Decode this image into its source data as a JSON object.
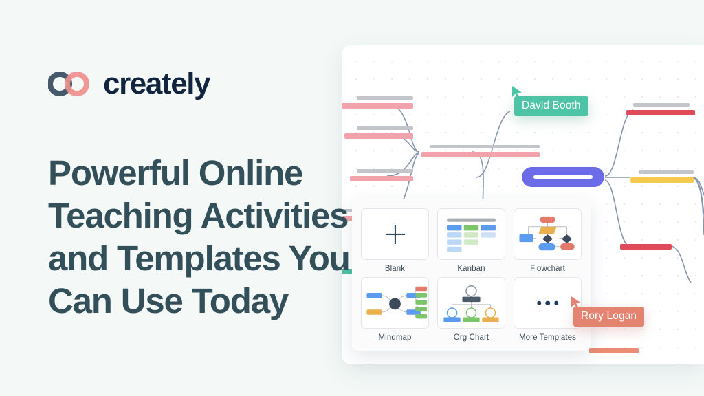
{
  "brand": {
    "name": "creately",
    "logo_icon": "interlocking-rings-icon",
    "wordmark_color": "#12253f",
    "ring_left_color": "#46596b",
    "ring_right_color": "#ef8f8c"
  },
  "hero": {
    "headline": "Powerful Online\nTeaching Activities\nand Templates You\nCan Use Today",
    "headline_color": "#33505a",
    "background_color": "#f4f9f7"
  },
  "canvas": {
    "background_color": "#ffffff",
    "grid_dot_color": "#cfd8e3",
    "connector_color": "#8795ad",
    "center_node_color": "#6c6ce8",
    "branch_colors": {
      "pink": "#f0a3ab",
      "gray": "#c2c6ca",
      "red": "#e04b5a",
      "yellow": "#f5cb4e",
      "teal": "#4fc0a5",
      "coral": "#ec8c78"
    }
  },
  "collaborators": [
    {
      "name": "David Booth",
      "color": "#4cc4a5",
      "cursor_icon": "cursor-arrow-icon"
    },
    {
      "name": "Rory Logan",
      "color": "#e38370",
      "cursor_icon": "cursor-arrow-icon"
    }
  ],
  "template_panel": {
    "background_color": "#fbfbfc",
    "items": [
      {
        "label": "Blank",
        "icon": "plus-icon"
      },
      {
        "label": "Kanban",
        "icon": "kanban-board-icon"
      },
      {
        "label": "Flowchart",
        "icon": "flowchart-icon"
      },
      {
        "label": "Mindmap",
        "icon": "mindmap-icon"
      },
      {
        "label": "Org Chart",
        "icon": "org-chart-icon"
      },
      {
        "label": "More Templates",
        "icon": "ellipsis-icon"
      }
    ]
  }
}
